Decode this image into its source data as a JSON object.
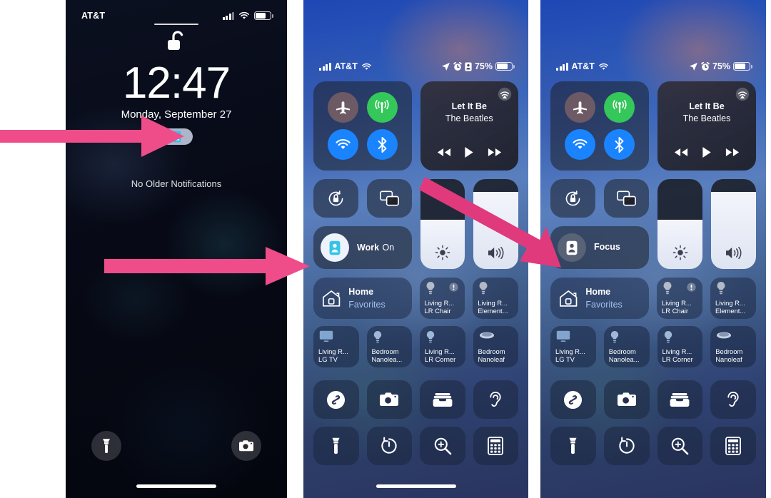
{
  "arrow_color": "#ee4d8a",
  "arrow_color_dark": "#e03a7c",
  "lock_screen": {
    "carrier": "AT&T",
    "time": "12:47",
    "date": "Monday, September 27",
    "notifications_text": "No Older Notifications",
    "focus_pill_icon": "focus-person-icon",
    "lock_icon": "unlocked-padlock-icon",
    "bottom_left_icon": "flashlight-icon",
    "bottom_right_icon": "camera-icon",
    "status": {
      "signal_icon": "cellular-bars-icon",
      "wifi_icon": "wifi-icon",
      "battery_icon": "battery-icon",
      "battery_fill_pct": 72
    }
  },
  "control_center_on": {
    "status": {
      "signal_icon": "cellular-bars-icon",
      "carrier": "AT&T",
      "wifi_icon": "wifi-icon",
      "location_icon": "location-arrow-icon",
      "alarm_icon": "alarm-clock-icon",
      "focus_icon": "focus-person-icon",
      "battery_pct": "75%",
      "battery_icon": "battery-icon",
      "battery_fill_pct": 75
    },
    "connectivity": {
      "airplane_icon": "airplane-mode-icon",
      "cellular_icon": "cellular-data-icon",
      "wifi_icon": "wifi-icon",
      "bluetooth_icon": "bluetooth-icon"
    },
    "media": {
      "airplay_icon": "airplay-audio-icon",
      "title": "Let It Be",
      "artist": "The Beatles",
      "rewind_icon": "rewind-icon",
      "play_icon": "play-icon",
      "forward_icon": "fast-forward-icon"
    },
    "toggles": {
      "rotation_lock_icon": "rotation-lock-icon",
      "screen_mirroring_icon": "screen-mirroring-icon"
    },
    "focus": {
      "icon": "focus-person-icon",
      "name": "Work",
      "state": "On",
      "active": true
    },
    "sliders": {
      "brightness_icon": "brightness-icon",
      "brightness_pct": 55,
      "volume_icon": "volume-icon",
      "volume_pct": 86
    },
    "home": {
      "icon": "home-icon",
      "title": "Home",
      "subtitle": "Favorites",
      "accessories_row1": [
        {
          "icon": "lightbulb-icon",
          "warning_icon": "warning-icon",
          "line1": "Living R...",
          "line2": "LR Chair"
        },
        {
          "icon": "lightbulb-icon",
          "line1": "Living R...",
          "line2": "Element..."
        }
      ],
      "accessories_row2": [
        {
          "icon": "tv-icon",
          "line1": "Living R...",
          "line2": "LG TV"
        },
        {
          "icon": "lightbulb-icon",
          "line1": "Bedroom",
          "line2": "Nanolea..."
        },
        {
          "icon": "lightbulb-icon",
          "line1": "Living R...",
          "line2": "LR Corner"
        },
        {
          "icon": "lamp-icon",
          "line1": "Bedroom",
          "line2": "Nanoleaf"
        }
      ]
    },
    "apps_row1": [
      "shazam-icon",
      "camera-icon",
      "wallet-icon",
      "hearing-ear-icon"
    ],
    "apps_row2": [
      "flashlight-icon",
      "timer-icon",
      "magnifier-icon",
      "calculator-icon"
    ]
  },
  "control_center_off": {
    "status": {
      "signal_icon": "cellular-bars-icon",
      "carrier": "AT&T",
      "wifi_icon": "wifi-icon",
      "location_icon": "location-arrow-icon",
      "alarm_icon": "alarm-clock-icon",
      "battery_pct": "75%",
      "battery_icon": "battery-icon",
      "battery_fill_pct": 75
    },
    "connectivity": {
      "airplane_icon": "airplane-mode-icon",
      "cellular_icon": "cellular-data-icon",
      "wifi_icon": "wifi-icon",
      "bluetooth_icon": "bluetooth-icon"
    },
    "media": {
      "airplay_icon": "airplay-audio-icon",
      "title": "Let It Be",
      "artist": "The Beatles",
      "rewind_icon": "rewind-icon",
      "play_icon": "play-icon",
      "forward_icon": "fast-forward-icon"
    },
    "toggles": {
      "rotation_lock_icon": "rotation-lock-icon",
      "screen_mirroring_icon": "screen-mirroring-icon"
    },
    "focus": {
      "icon": "focus-person-icon",
      "name": "Focus",
      "state": "",
      "active": false
    },
    "sliders": {
      "brightness_icon": "brightness-icon",
      "brightness_pct": 55,
      "volume_icon": "volume-icon",
      "volume_pct": 86
    },
    "home": {
      "icon": "home-icon",
      "title": "Home",
      "subtitle": "Favorites",
      "accessories_row1": [
        {
          "icon": "lightbulb-icon",
          "warning_icon": "warning-icon",
          "line1": "Living R...",
          "line2": "LR Chair"
        },
        {
          "icon": "lightbulb-icon",
          "line1": "Living R...",
          "line2": "Element..."
        }
      ],
      "accessories_row2": [
        {
          "icon": "tv-icon",
          "line1": "Living R...",
          "line2": "LG TV"
        },
        {
          "icon": "lightbulb-icon",
          "line1": "Bedroom",
          "line2": "Nanolea..."
        },
        {
          "icon": "lightbulb-icon",
          "line1": "Living R...",
          "line2": "LR Corner"
        },
        {
          "icon": "lamp-icon",
          "line1": "Bedroom",
          "line2": "Nanoleaf"
        }
      ]
    },
    "apps_row1": [
      "shazam-icon",
      "camera-icon",
      "wallet-icon",
      "hearing-ear-icon"
    ],
    "apps_row2": [
      "flashlight-icon",
      "timer-icon",
      "magnifier-icon",
      "calculator-icon"
    ]
  }
}
